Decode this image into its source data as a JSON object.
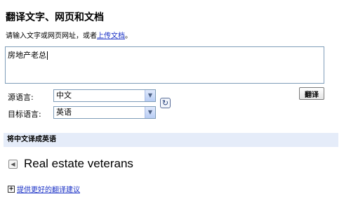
{
  "header": {
    "title": "翻译文字、网页和文档",
    "instruction_prefix": "请输入文字或网页网址，或者",
    "upload_link": "上传文档",
    "instruction_suffix": "。"
  },
  "input": {
    "value": "房地产老总"
  },
  "source_language": {
    "label": "源语言:",
    "selected": "中文"
  },
  "target_language": {
    "label": "目标语言:",
    "selected": "英语"
  },
  "translate_button": {
    "label": "翻译"
  },
  "icons": {
    "swap": "swap-languages-icon",
    "speaker": "speaker-icon",
    "plus": "plus-box-icon"
  },
  "result": {
    "heading": "将中文译成英语",
    "text": "Real estate veterans"
  },
  "suggest_link": {
    "label": "提供更好的翻译建议"
  },
  "colors": {
    "link": "#1a31c6",
    "band": "#e5ecf9",
    "border": "#7f9db9"
  }
}
